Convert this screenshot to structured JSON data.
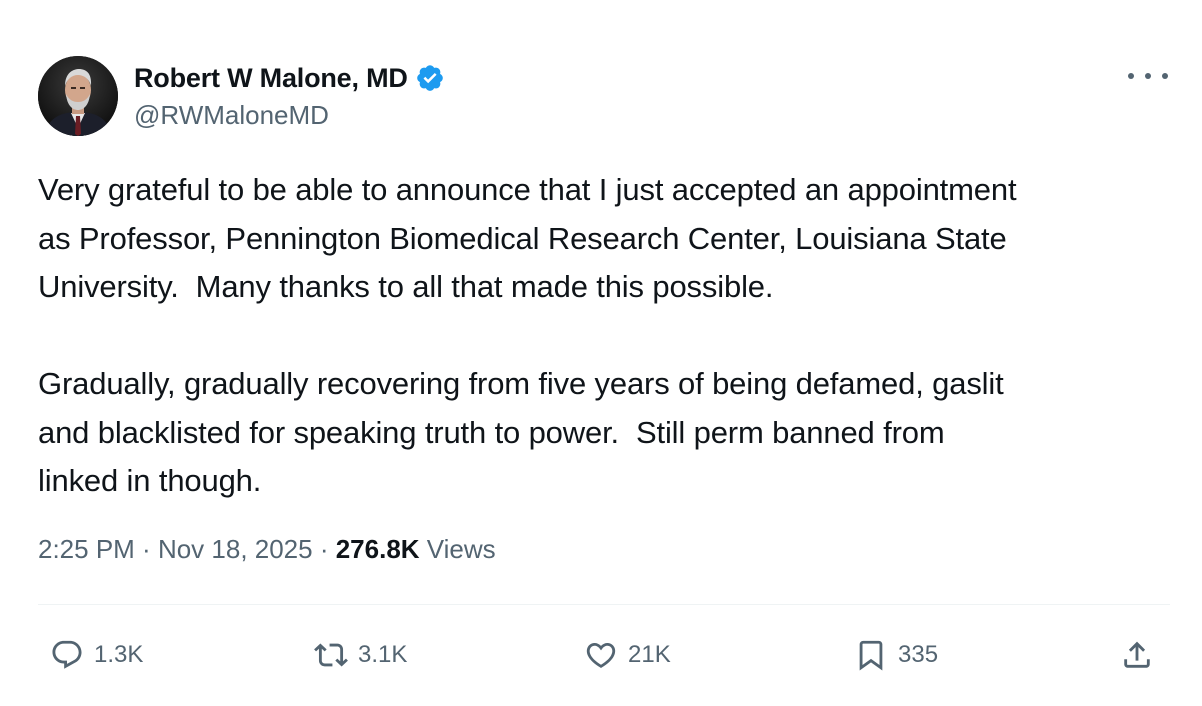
{
  "author": {
    "display_name": "Robert W Malone, MD",
    "handle": "@RWMaloneMD",
    "verified_icon": "verified-badge-icon",
    "verified_color": "#1d9bf0"
  },
  "tweet": {
    "text": "Very grateful to be able to announce that I just accepted an appointment\nas Professor, Pennington Biomedical Research Center, Louisiana State\nUniversity.  Many thanks to all that made this possible.\n\nGradually, gradually recovering from five years of being defamed, gaslit\nand blacklisted for speaking truth to power.  Still perm banned from\nlinked in though.",
    "time": "2:25 PM",
    "separator": " · ",
    "date": "Nov 18, 2025",
    "views_count": "276.8K",
    "views_label": " Views"
  },
  "actions": {
    "reply": {
      "icon": "reply-icon",
      "count": "1.3K"
    },
    "retweet": {
      "icon": "retweet-icon",
      "count": "3.1K"
    },
    "like": {
      "icon": "heart-icon",
      "count": "21K"
    },
    "bookmark": {
      "icon": "bookmark-icon",
      "count": "335"
    },
    "share": {
      "icon": "share-icon"
    }
  },
  "colors": {
    "text_primary": "#0f1419",
    "text_secondary": "#536471",
    "divider": "#eff3f4"
  }
}
